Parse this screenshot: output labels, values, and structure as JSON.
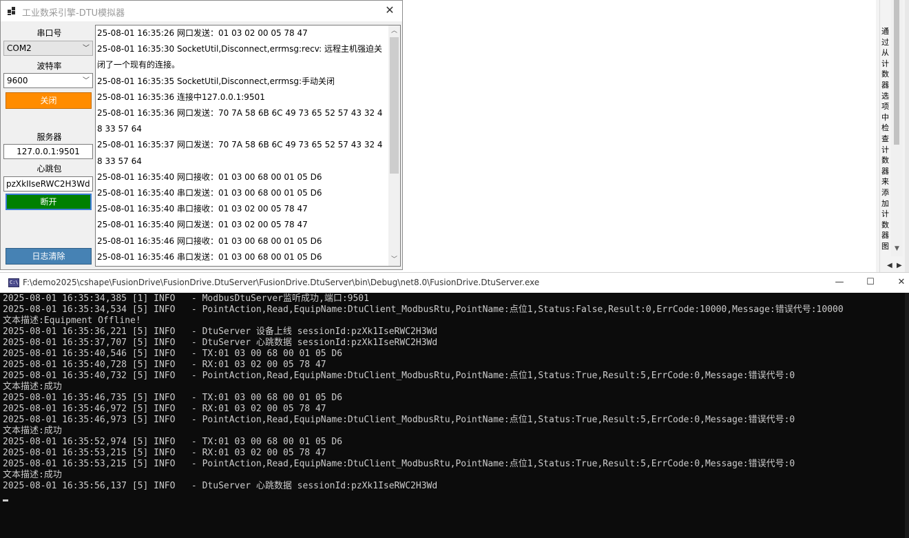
{
  "dtu_window": {
    "title": "工业数采引擎-DTU模拟器",
    "close_glyph": "✕",
    "serial_port_label": "串口号",
    "serial_port_value": "COM2",
    "baud_rate_label": "波特率",
    "baud_rate_value": "9600",
    "close_button_label": "关闭",
    "server_label": "服务器",
    "server_value": "127.0.0.1:9501",
    "heartbeat_label": "心跳包",
    "heartbeat_value": "pzXkIIseRWC2H3Wd",
    "disconnect_button_label": "断开",
    "clear_log_button_label": "日志清除",
    "log_lines": [
      "25-08-01 16:35:26 网口发送：01 03 02 00 05 78 47",
      "25-08-01 16:35:30 SocketUtil,Disconnect,errmsg:recv: 远程主机强迫关闭了一个现有的连接。",
      "25-08-01 16:35:35 SocketUtil,Disconnect,errmsg:手动关闭",
      "25-08-01 16:35:36 连接中127.0.0.1:9501",
      "25-08-01 16:35:36 网口发送：70 7A 58 6B 6C 49 73 65 52 57 43 32 48 33 57 64",
      "25-08-01 16:35:37 网口发送：70 7A 58 6B 6C 49 73 65 52 57 43 32 48 33 57 64",
      "25-08-01 16:35:40 网口接收：01 03 00 68 00 01 05 D6",
      "25-08-01 16:35:40 串口发送：01 03 00 68 00 01 05 D6",
      "25-08-01 16:35:40 串口接收：01 03 02 00 05 78 47",
      "25-08-01 16:35:40 网口发送：01 03 02 00 05 78 47",
      "25-08-01 16:35:46 网口接收：01 03 00 68 00 01 05 D6",
      "25-08-01 16:35:46 串口发送：01 03 00 68 00 01 05 D6"
    ]
  },
  "right_panel": {
    "vertical_text": "通过从计数器选项中检查计数器来添加计数器图"
  },
  "console_window": {
    "path": "F:\\demo2025\\cshape\\FusionDrive\\FusionDrive.DtuServer\\FusionDrive.DtuServer\\bin\\Debug\\net8.0\\FusionDrive.DtuServer.exe",
    "icon_text": "C:\\",
    "minimize_glyph": "—",
    "maximize_glyph": "☐",
    "close_glyph": "✕",
    "lines": [
      "2025-08-01 16:35:34,385 [1] INFO   - ModbusDtuServer监听成功,端口:9501",
      "2025-08-01 16:35:34,534 [5] INFO   - PointAction,Read,EquipName:DtuClient_ModbusRtu,PointName:点位1,Status:False,Result:0,ErrCode:10000,Message:错误代号:10000",
      "文本描述:Equipment Offline!",
      "2025-08-01 16:35:36,221 [5] INFO   - DtuServer 设备上线 sessionId:pzXk1IseRWC2H3Wd",
      "2025-08-01 16:35:37,707 [5] INFO   - DtuServer 心跳数据 sessionId:pzXk1IseRWC2H3Wd",
      "2025-08-01 16:35:40,546 [5] INFO   - TX:01 03 00 68 00 01 05 D6",
      "2025-08-01 16:35:40,728 [5] INFO   - RX:01 03 02 00 05 78 47",
      "2025-08-01 16:35:40,732 [5] INFO   - PointAction,Read,EquipName:DtuClient_ModbusRtu,PointName:点位1,Status:True,Result:5,ErrCode:0,Message:错误代号:0",
      "文本描述:成功",
      "2025-08-01 16:35:46,735 [5] INFO   - TX:01 03 00 68 00 01 05 D6",
      "2025-08-01 16:35:46,972 [5] INFO   - RX:01 03 02 00 05 78 47",
      "2025-08-01 16:35:46,973 [5] INFO   - PointAction,Read,EquipName:DtuClient_ModbusRtu,PointName:点位1,Status:True,Result:5,ErrCode:0,Message:错误代号:0",
      "文本描述:成功",
      "2025-08-01 16:35:52,974 [5] INFO   - TX:01 03 00 68 00 01 05 D6",
      "2025-08-01 16:35:53,215 [5] INFO   - RX:01 03 02 00 05 78 47",
      "2025-08-01 16:35:53,215 [5] INFO   - PointAction,Read,EquipName:DtuClient_ModbusRtu,PointName:点位1,Status:True,Result:5,ErrCode:0,Message:错误代号:0",
      "文本描述:成功",
      "2025-08-01 16:35:56,137 [5] INFO   - DtuServer 心跳数据 sessionId:pzXk1IseRWC2H3Wd"
    ]
  }
}
